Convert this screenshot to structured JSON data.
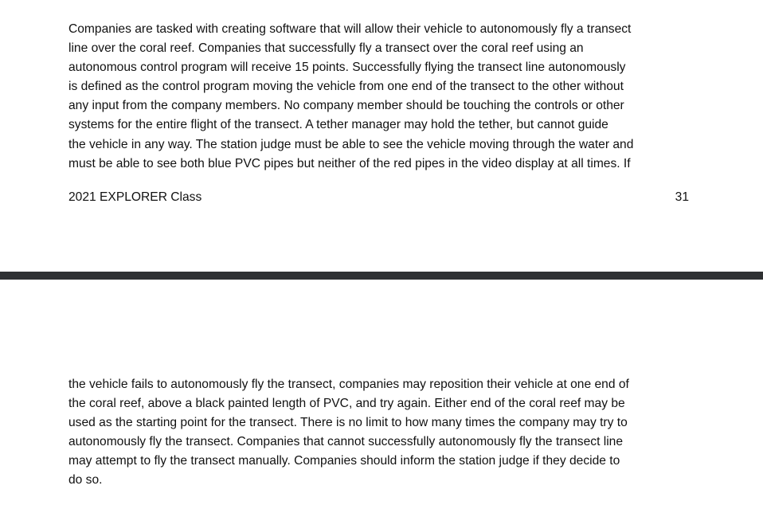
{
  "page1": {
    "paragraph_lines": [
      "Companies are tasked with creating software that will allow their vehicle to autonomously fly a transect",
      "line over the coral reef.  Companies that successfully fly a transect over the coral reef using an",
      "autonomous control program will receive 15 points.  Successfully flying the transect line autonomously",
      "is defined as the control program moving the vehicle from one end of the transect to the other without",
      "any input from the company members.  No company member should be touching the controls or other",
      "systems for the entire flight of the transect.  A tether manager may hold the tether, but cannot guide",
      "the vehicle in any way.  The station judge must be able to see the vehicle moving through the water and",
      "must be able to see both blue PVC pipes but neither of the red pipes in the video display at all times.  If"
    ],
    "footer_left": "2021 EXPLORER Class",
    "footer_page_number": "31"
  },
  "page2": {
    "paragraph_lines": [
      "the vehicle fails to autonomously fly the transect, companies may reposition their vehicle at one end of",
      "the coral reef, above a black painted length of PVC, and try again.  Either end of the coral reef may be",
      "used as the starting point for the transect.  There is no limit to how many times the company may try to",
      "autonomously fly the transect.  Companies that cannot successfully autonomously fly the transect line",
      "may attempt to fly the transect manually.  Companies should inform the station judge if they decide to",
      "do so."
    ]
  }
}
